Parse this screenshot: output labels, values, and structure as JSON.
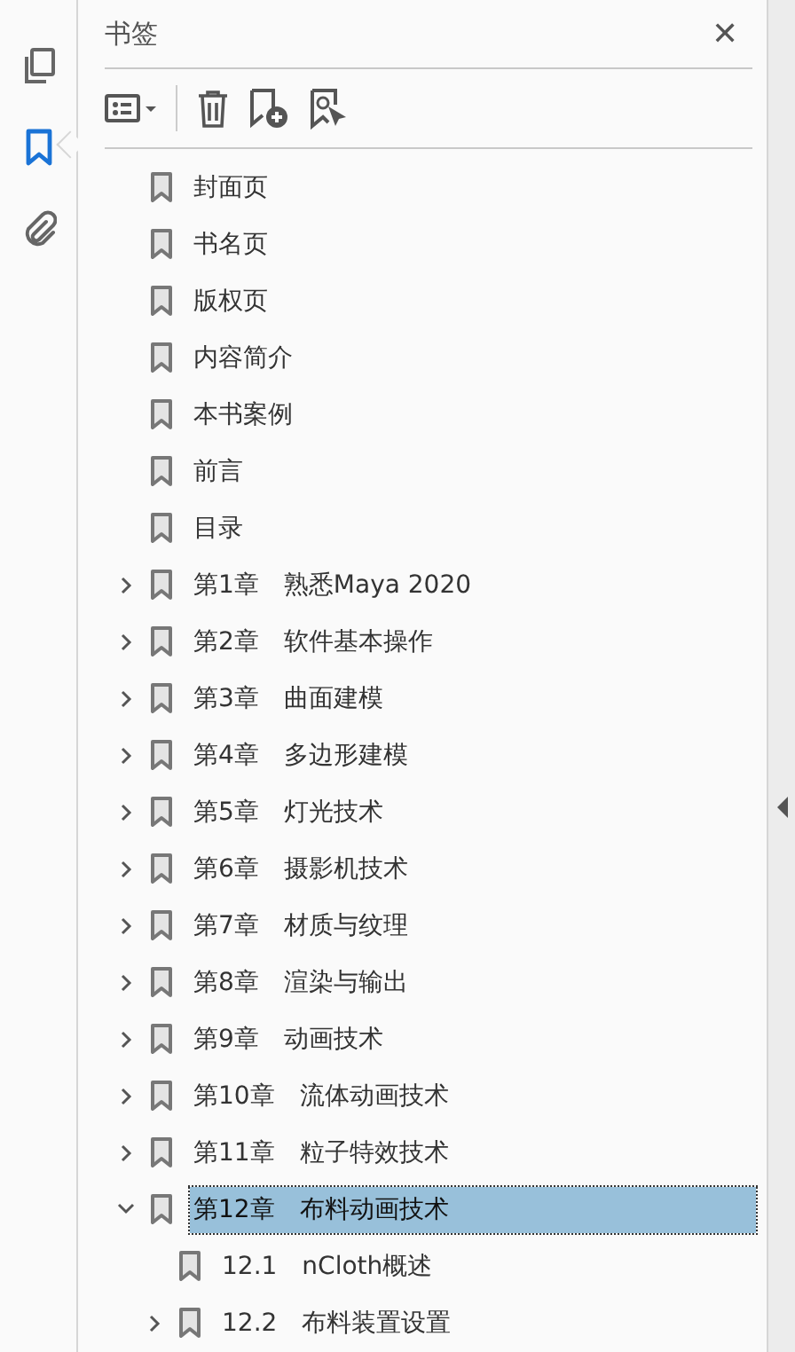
{
  "rail": [
    {
      "kind": "pages",
      "selected": false
    },
    {
      "kind": "bookmarks",
      "selected": true
    },
    {
      "kind": "attachments",
      "selected": false
    }
  ],
  "panel": {
    "title": "书签",
    "close": "✕"
  },
  "bookmarks": [
    {
      "title": "封面页",
      "kind": "leaf",
      "selected": false
    },
    {
      "title": "书名页",
      "kind": "leaf",
      "selected": false
    },
    {
      "title": "版权页",
      "kind": "leaf",
      "selected": false
    },
    {
      "title": "内容简介",
      "kind": "leaf",
      "selected": false
    },
    {
      "title": "本书案例",
      "kind": "leaf",
      "selected": false
    },
    {
      "title": "前言",
      "kind": "leaf",
      "selected": false
    },
    {
      "title": "目录",
      "kind": "leaf",
      "selected": false
    },
    {
      "title": "第1章　熟悉Maya 2020",
      "kind": "branch",
      "expanded": false,
      "selected": false
    },
    {
      "title": "第2章　软件基本操作",
      "kind": "branch",
      "expanded": false,
      "selected": false
    },
    {
      "title": "第3章　曲面建模",
      "kind": "branch",
      "expanded": false,
      "selected": false
    },
    {
      "title": "第4章　多边形建模",
      "kind": "branch",
      "expanded": false,
      "selected": false
    },
    {
      "title": "第5章　灯光技术",
      "kind": "branch",
      "expanded": false,
      "selected": false
    },
    {
      "title": "第6章　摄影机技术",
      "kind": "branch",
      "expanded": false,
      "selected": false
    },
    {
      "title": "第7章　材质与纹理",
      "kind": "branch",
      "expanded": false,
      "selected": false
    },
    {
      "title": "第8章　渲染与输出",
      "kind": "branch",
      "expanded": false,
      "selected": false
    },
    {
      "title": "第9章　动画技术",
      "kind": "branch",
      "expanded": false,
      "selected": false
    },
    {
      "title": "第10章　流体动画技术",
      "kind": "branch",
      "expanded": false,
      "selected": false
    },
    {
      "title": "第11章　粒子特效技术",
      "kind": "branch",
      "expanded": false,
      "selected": false
    },
    {
      "title": "第12章　布料动画技术",
      "kind": "branch",
      "expanded": true,
      "selected": true,
      "children": [
        {
          "title": "12.1　nCloth概述",
          "kind": "leaf",
          "selected": false
        },
        {
          "title": "12.2　布料装置设置",
          "kind": "branch",
          "expanded": false,
          "selected": false
        }
      ]
    }
  ]
}
